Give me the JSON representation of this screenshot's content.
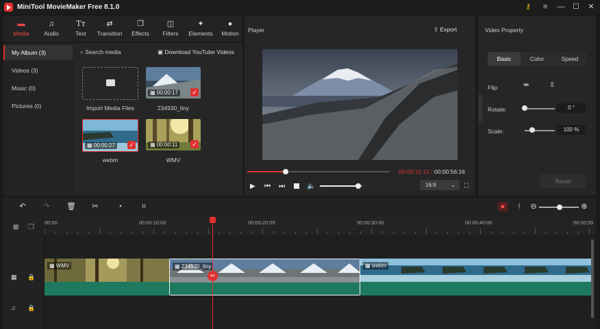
{
  "app": {
    "title": "MiniTool MovieMaker Free 8.1.0"
  },
  "toolbar": {
    "items": [
      {
        "label": "Media",
        "icon": "folder-icon"
      },
      {
        "label": "Audio",
        "icon": "music-note-icon"
      },
      {
        "label": "Text",
        "icon": "text-icon"
      },
      {
        "label": "Transition",
        "icon": "transition-icon"
      },
      {
        "label": "Effects",
        "icon": "effects-icon"
      },
      {
        "label": "Filters",
        "icon": "filters-icon"
      },
      {
        "label": "Elements",
        "icon": "elements-icon"
      },
      {
        "label": "Motion",
        "icon": "motion-icon"
      }
    ]
  },
  "sidebar": {
    "items": [
      {
        "label": "My Album (3)"
      },
      {
        "label": "Videos (3)"
      },
      {
        "label": "Music (0)"
      },
      {
        "label": "Pictures (0)"
      }
    ]
  },
  "media": {
    "search_placeholder": "Search media",
    "download_label": "Download YouTube Videos",
    "import_label": "Import Media Files",
    "items": [
      {
        "name": "234930_tiny",
        "duration": "00:00:17"
      },
      {
        "name": "webm",
        "duration": "00:00:27"
      },
      {
        "name": "WMV",
        "duration": "00:00:11"
      }
    ]
  },
  "player": {
    "title": "Player",
    "export_label": "Export",
    "current_time": "00:00:15:12",
    "separator": " / ",
    "total_time": "00:00:56:16",
    "aspect_ratio": "16:9",
    "progress": 0.27,
    "volume": 0.9
  },
  "properties": {
    "title": "Video Property",
    "tabs": [
      "Basic",
      "Color",
      "Speed"
    ],
    "flip_label": "Flip:",
    "rotate_label": "Rotate:",
    "rotate_value": "0 °",
    "scale_label": "Scale:",
    "scale_value": "100 %",
    "reset_label": "Reset",
    "rotate_level": 0.0,
    "scale_level": 0.25
  },
  "timeline": {
    "ruler_labels": [
      "00:00",
      "00:00:10:00",
      "00:00:20:00",
      "00:00:30:00",
      "00:00:40:00",
      "00:00:50"
    ],
    "clips": [
      {
        "label": "WMV"
      },
      {
        "label": "234930_tiny"
      },
      {
        "label": "webm"
      }
    ],
    "zoom_level": 0.45
  },
  "colors": {
    "accent": "#e03030",
    "audio_track": "#1e7a5e"
  }
}
